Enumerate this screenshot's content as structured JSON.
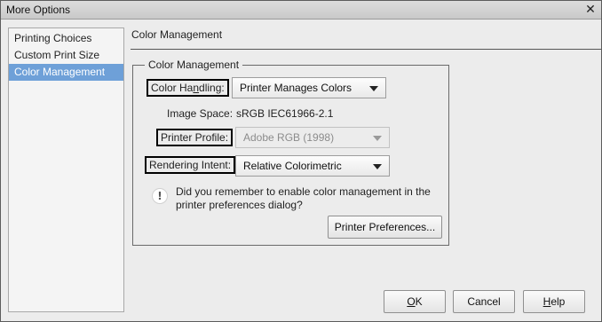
{
  "window": {
    "title": "More Options",
    "close_glyph": "✕"
  },
  "sidebar": {
    "items": [
      {
        "label": "Printing Choices",
        "selected": false
      },
      {
        "label": "Custom Print Size",
        "selected": false
      },
      {
        "label": "Color Management",
        "selected": true
      }
    ]
  },
  "panel": {
    "header": "Color Management",
    "group_title": "Color Management"
  },
  "color_handling": {
    "label_pre": "Color Ha",
    "label_underlined": "n",
    "label_post": "dling:",
    "value": "Printer Manages Colors"
  },
  "image_space": {
    "label": "Image Space:",
    "value": "sRGB IEC61966-2.1"
  },
  "printer_profile": {
    "label": "Printer Profile:",
    "value": "Adobe RGB (1998)",
    "disabled": true
  },
  "rendering_intent": {
    "label": "Rendering Intent:",
    "value": "Relative Colorimetric"
  },
  "note": {
    "icon": "info-icon",
    "text": "Did you remember to enable color management in the printer preferences dialog?"
  },
  "buttons": {
    "printer_preferences": "Printer Preferences...",
    "ok_underlined": "O",
    "ok_rest": "K",
    "cancel": "Cancel",
    "help_underlined": "H",
    "help_rest": "elp"
  },
  "colors": {
    "selection": "#6ea0d8",
    "background": "#ececec"
  }
}
